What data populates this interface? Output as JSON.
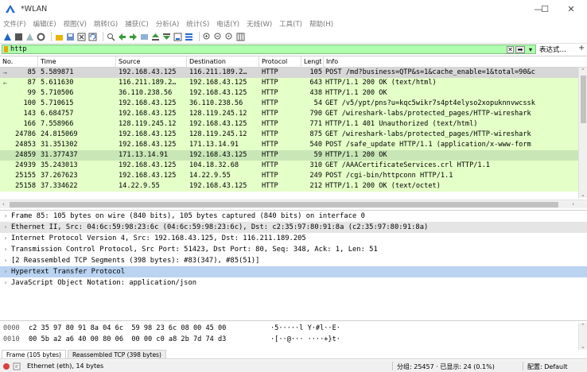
{
  "window": {
    "title": "*WLAN",
    "minimize": "—",
    "maximize": "☐",
    "close": "✕"
  },
  "menu": [
    "文件(F)",
    "编辑(E)",
    "视图(V)",
    "跳转(G)",
    "捕获(C)",
    "分析(A)",
    "统计(S)",
    "电话(Y)",
    "无线(W)",
    "工具(T)",
    "帮助(H)"
  ],
  "filter": {
    "value": "http",
    "expression_label": "表达式…",
    "plus_label": "+"
  },
  "packet_list": {
    "columns": [
      "No.",
      "Time",
      "Source",
      "Destination",
      "Protocol",
      "Lengt",
      "Info"
    ],
    "rows": [
      {
        "no": "85",
        "time": "5.589871",
        "src": "192.168.43.125",
        "dst": "116.211.189.2…",
        "proto": "HTTP",
        "len": "105",
        "info": "POST /md?business=QTP&s=1&cache_enable=1&total=90&c",
        "style": "selected",
        "mark": "→"
      },
      {
        "no": "87",
        "time": "5.611630",
        "src": "116.211.189.2…",
        "dst": "192.168.43.125",
        "proto": "HTTP",
        "len": "643",
        "info": "HTTP/1.1 200 OK  (text/html)",
        "style": "http",
        "mark": "←"
      },
      {
        "no": "99",
        "time": "5.710506",
        "src": "36.110.238.56",
        "dst": "192.168.43.125",
        "proto": "HTTP",
        "len": "438",
        "info": "HTTP/1.1 200 OK",
        "style": "http",
        "mark": ""
      },
      {
        "no": "100",
        "time": "5.710615",
        "src": "192.168.43.125",
        "dst": "36.110.238.56",
        "proto": "HTTP",
        "len": "54",
        "info": "GET /v5/ypt/pns?u=kqc5wikr7s4pt4elyso2xopuknnvwcssk",
        "style": "http",
        "mark": ""
      },
      {
        "no": "143",
        "time": "6.684757",
        "src": "192.168.43.125",
        "dst": "128.119.245.12",
        "proto": "HTTP",
        "len": "790",
        "info": "GET /wireshark-labs/protected_pages/HTTP-wireshark",
        "style": "http",
        "mark": ""
      },
      {
        "no": "166",
        "time": "7.558966",
        "src": "128.119.245.12",
        "dst": "192.168.43.125",
        "proto": "HTTP",
        "len": "771",
        "info": "HTTP/1.1 401 Unauthorized  (text/html)",
        "style": "http",
        "mark": ""
      },
      {
        "no": "24786",
        "time": "24.815069",
        "src": "192.168.43.125",
        "dst": "128.119.245.12",
        "proto": "HTTP",
        "len": "875",
        "info": "GET /wireshark-labs/protected_pages/HTTP-wireshark",
        "style": "http",
        "mark": ""
      },
      {
        "no": "24853",
        "time": "31.351302",
        "src": "192.168.43.125",
        "dst": "171.13.14.91",
        "proto": "HTTP",
        "len": "540",
        "info": "POST /safe_update HTTP/1.1  (application/x-www-form",
        "style": "http",
        "mark": ""
      },
      {
        "no": "24859",
        "time": "31.377437",
        "src": "171.13.14.91",
        "dst": "192.168.43.125",
        "proto": "HTTP",
        "len": "59",
        "info": "HTTP/1.1 200 OK",
        "style": "related",
        "mark": ""
      },
      {
        "no": "24939",
        "time": "35.243013",
        "src": "192.168.43.125",
        "dst": "104.18.32.68",
        "proto": "HTTP",
        "len": "310",
        "info": "GET /AAACertificateServices.crl HTTP/1.1",
        "style": "http",
        "mark": ""
      },
      {
        "no": "25155",
        "time": "37.267623",
        "src": "192.168.43.125",
        "dst": "14.22.9.55",
        "proto": "HTTP",
        "len": "249",
        "info": "POST /cgi-bin/httpconn HTTP/1.1",
        "style": "http",
        "mark": ""
      },
      {
        "no": "25158",
        "time": "37.334622",
        "src": "14.22.9.55",
        "dst": "192.168.43.125",
        "proto": "HTTP",
        "len": "212",
        "info": "HTTP/1.1 200 OK  (text/octet)",
        "style": "http",
        "mark": ""
      }
    ]
  },
  "details": [
    {
      "text": "Frame 85: 105 bytes on wire (840 bits), 105 bytes captured (840 bits) on interface 0",
      "arrow": "›",
      "style": ""
    },
    {
      "text": "Ethernet II, Src: 04:6c:59:98:23:6c (04:6c:59:98:23:6c), Dst: c2:35:97:80:91:8a (c2:35:97:80:91:8a)",
      "arrow": "›",
      "style": "light"
    },
    {
      "text": "Internet Protocol Version 4, Src: 192.168.43.125, Dst: 116.211.189.205",
      "arrow": "›",
      "style": ""
    },
    {
      "text": "Transmission Control Protocol, Src Port: 51423, Dst Port: 80, Seq: 348, Ack: 1, Len: 51",
      "arrow": "›",
      "style": ""
    },
    {
      "text": "[2 Reassembled TCP Segments (398 bytes): #83(347), #85(51)]",
      "arrow": "›",
      "style": ""
    },
    {
      "text": "Hypertext Transfer Protocol",
      "arrow": "›",
      "style": "selected"
    },
    {
      "text": "JavaScript Object Notation: application/json",
      "arrow": "›",
      "style": ""
    }
  ],
  "bytes": [
    {
      "offset": "0000",
      "hex": "c2 35 97 80 91 8a 04 6c  59 98 23 6c 08 00 45 00",
      "ascii": "·5·····l Y·#l··E·"
    },
    {
      "offset": "0010",
      "hex": "00 5b a2 a6 40 00 80 06  00 00 c0 a8 2b 7d 74 d3",
      "ascii": "·[··@··· ····+}t·"
    }
  ],
  "byte_tabs": [
    "Frame (105 bytes)",
    "Reassembled TCP (398 bytes)"
  ],
  "status": {
    "left": "Ethernet (eth), 14 bytes",
    "packets": "分组: 25457 · 已显示: 24 (0.1%)",
    "profile": "配置: Default"
  },
  "colors": {
    "http_row": "#e4ffc7",
    "selected_row": "#d7d7d7",
    "filter_ok": "#afffaf",
    "detail_selected": "#b9d3f1",
    "shark_blue": "#2266cc"
  }
}
